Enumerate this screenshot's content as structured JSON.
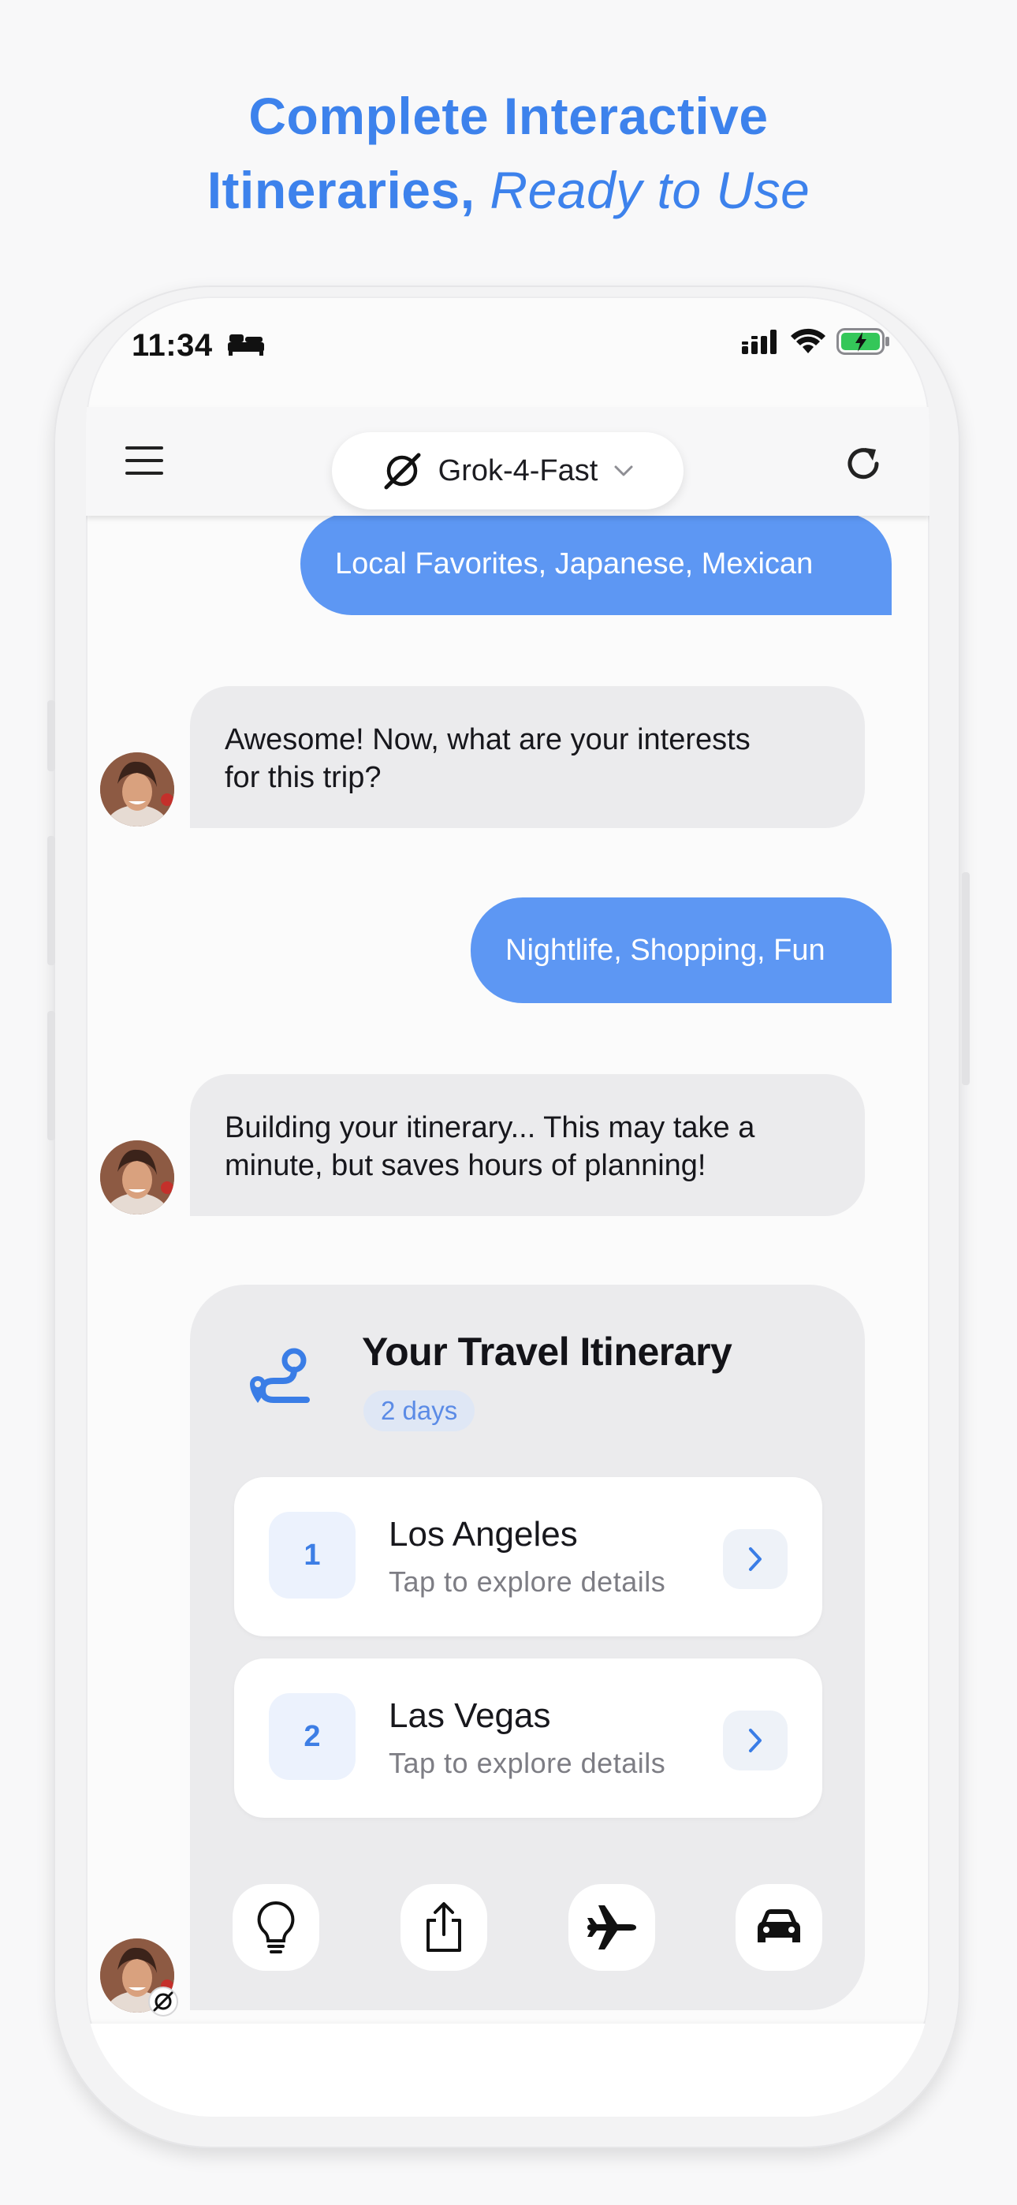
{
  "headline": {
    "line1": "Complete Interactive",
    "line2_bold": "Itineraries,",
    "line2_italic": "Ready to Use"
  },
  "status_bar": {
    "time": "11:34",
    "icons": [
      "bed-icon",
      "cellular-signal-icon",
      "wifi-icon",
      "battery-charging-icon"
    ]
  },
  "navbar": {
    "menu_icon": "hamburger-menu-icon",
    "model_icon": "grok-logo-icon",
    "model_name": "Grok-4-Fast",
    "dropdown_icon": "chevron-down-icon",
    "refresh_icon": "refresh-icon"
  },
  "chat": {
    "messages": [
      {
        "role": "user",
        "text": "Local Favorites, Japanese, Mexican"
      },
      {
        "role": "assistant",
        "lines": [
          "Awesome! Now, what are your interests",
          "for this trip?"
        ]
      },
      {
        "role": "user",
        "text": "Nightlife, Shopping, Fun"
      },
      {
        "role": "assistant",
        "lines": [
          "Building your itinerary... This may take a",
          "minute, but saves hours of planning!"
        ]
      }
    ]
  },
  "itinerary": {
    "icon": "route-icon",
    "title": "Your Travel Itinerary",
    "badge": "2 days",
    "days": [
      {
        "number": "1",
        "city": "Los Angeles",
        "subtitle": "Tap to explore details"
      },
      {
        "number": "2",
        "city": "Las Vegas",
        "subtitle": "Tap to explore details"
      }
    ],
    "actions": [
      "lightbulb-icon",
      "share-icon",
      "airplane-icon",
      "car-icon"
    ]
  },
  "colors": {
    "accent": "#3d82ec",
    "user_bubble": "#5d97f3",
    "bot_bubble": "#ebebed"
  }
}
